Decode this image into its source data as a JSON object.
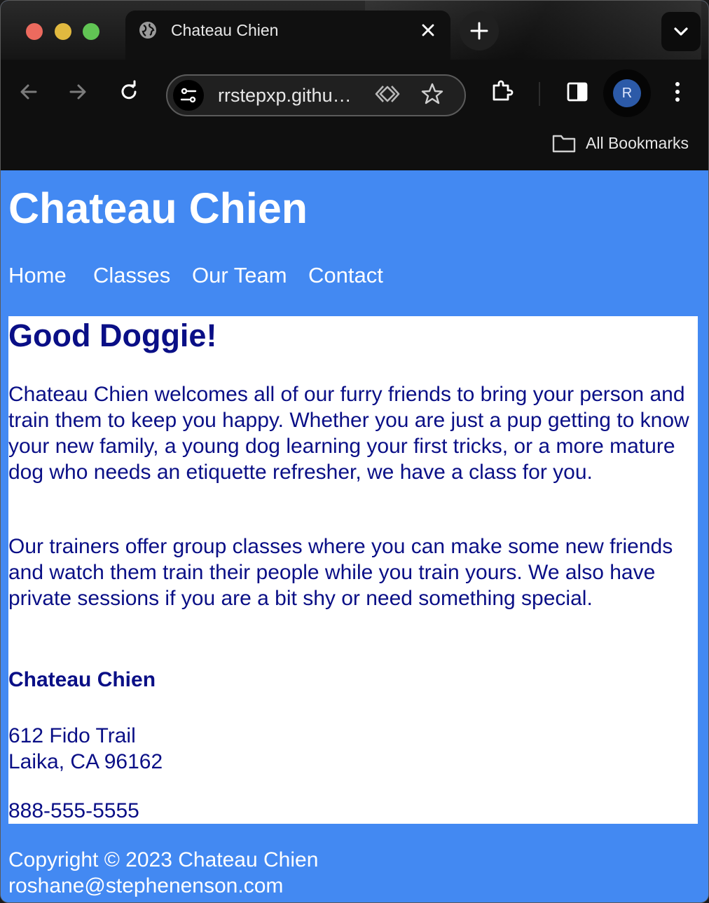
{
  "browser": {
    "tab_title": "Chateau Chien",
    "url": "rrstepxp.githu…",
    "bookmarks_label": "All Bookmarks",
    "profile_initial": "R"
  },
  "site": {
    "title": "Chateau Chien",
    "nav": [
      "Home",
      "Classes",
      "Our Team",
      "Contact"
    ]
  },
  "main": {
    "heading": "Good Doggie!",
    "paragraph1": "Chateau Chien welcomes all of our furry friends to bring your person and train them to keep you happy. Whether you are just a pup getting to know your new family, a young dog learning your first tricks, or a more mature dog who needs an etiquette refresher, we have a class for you.",
    "paragraph2": "Our trainers offer group classes where you can make some new friends and watch them train their people while you train yours. We also have private sessions if you are a bit shy or need something special.",
    "address": {
      "name": "Chateau Chien",
      "street": "612 Fido Trail",
      "city": "Laika, CA 96162",
      "phone": "888-555-5555"
    }
  },
  "footer": {
    "copyright": "Copyright © 2023 Chateau Chien",
    "email": "roshane@stephenenson.com"
  }
}
